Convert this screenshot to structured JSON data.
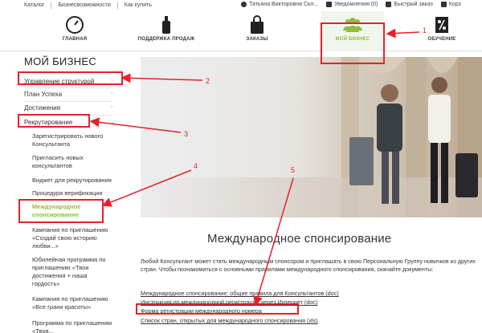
{
  "topbar": {
    "links": [
      "Каталог",
      "Бизнесвозможности",
      "Как купить"
    ],
    "user_name": "Татьяна Викторовна Скл...",
    "notifications": "Уведомления (0)",
    "quick_order": "Быстрый заказ",
    "cart": "Корз"
  },
  "nav": {
    "items": [
      {
        "label": "ГЛАВНАЯ"
      },
      {
        "label": "ПОДДЕРЖКА ПРОДАЖ"
      },
      {
        "label": "ЗАКАЗЫ"
      },
      {
        "label": "МОЙ БИЗНЕС"
      },
      {
        "label": "ОБУЧЕНИЕ"
      }
    ]
  },
  "sidebar": {
    "title": "МОЙ БИЗНЕС",
    "items": [
      {
        "label": "Управление структурой"
      },
      {
        "label": "План Успеха"
      },
      {
        "label": "Достижения"
      },
      {
        "label": "Рекрутирование"
      }
    ],
    "sub_items": [
      {
        "label": "Зарегистрировать нового Консультанта"
      },
      {
        "label": "Пригласить новых консультантов"
      },
      {
        "label": "Виджет для рекрутирования"
      },
      {
        "label": "Процедура верификации"
      },
      {
        "label": "Международное спонсирование"
      },
      {
        "label": "Кампания по приглашению «Создай свою историю любви...»"
      },
      {
        "label": "Юбилейная программа по приглашению «Твои достижения + наша гордость»"
      },
      {
        "label": "Кампания по приглашению «Все грани красоты»"
      },
      {
        "label": "Программа по приглашению «Твоя..."
      }
    ]
  },
  "main": {
    "title": "Международное спонсирование",
    "paragraph": "Любой Консультант может стать международным спонсором и приглашать в свою Персональную Группу новичков из других стран. Чтобы познакомиться с основными правилами международного спонсирования, скачайте документы:",
    "docs": [
      "Международное спонсирование: общие правила для Консультантов (doc)",
      "Инструкция по международной регистрации через Интернет (doc)",
      "Форма регистрации международного номера",
      "Список стран, открытых для международного спонсирования (xls)"
    ]
  },
  "annotations": [
    "1",
    "2",
    "3",
    "4",
    "5"
  ],
  "colors": {
    "accent": "#8ebd3f",
    "annotation": "#e8202a"
  }
}
